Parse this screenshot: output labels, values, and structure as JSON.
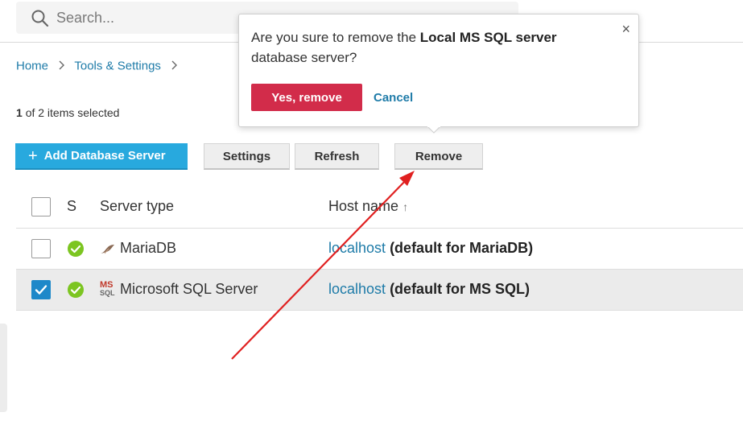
{
  "search": {
    "placeholder": "Search..."
  },
  "breadcrumb": [
    {
      "label": "Home"
    },
    {
      "label": "Tools & Settings"
    }
  ],
  "selection": {
    "count": "1",
    "text": "of 2 items selected"
  },
  "toolbar": {
    "add_label": "Add Database Server",
    "settings_label": "Settings",
    "refresh_label": "Refresh",
    "remove_label": "Remove"
  },
  "table": {
    "columns": {
      "status": "S",
      "server_type": "Server type",
      "host_name": "Host name",
      "sort_indicator": "↑"
    },
    "rows": [
      {
        "server_type": "MariaDB",
        "host_link": "localhost",
        "host_note": "(default for MariaDB)",
        "checked": false,
        "icon": "mariadb-icon"
      },
      {
        "server_type": "Microsoft SQL Server",
        "host_link": "localhost",
        "host_note": "(default for MS SQL)",
        "checked": true,
        "icon": "mssql-icon"
      }
    ]
  },
  "popover": {
    "text_before": "Are you sure to remove the ",
    "server_name": "Local MS SQL server",
    "text_after": " database server?",
    "confirm_label": "Yes, remove",
    "cancel_label": "Cancel",
    "close_icon": "×"
  },
  "mssql_icon_text": {
    "top": "MS",
    "bottom": "SQL"
  },
  "colors": {
    "accent": "#28a9de",
    "link": "#1e7ba8",
    "danger": "#d22c4a",
    "status_ok": "#7cc521",
    "annotation_arrow": "#e02020"
  }
}
